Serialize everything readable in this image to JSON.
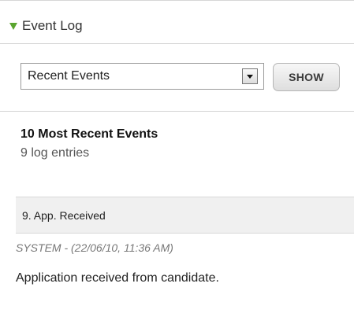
{
  "panel": {
    "title": "Event Log"
  },
  "filter": {
    "selected": "Recent Events",
    "show_label": "SHOW"
  },
  "events": {
    "heading": "10 Most Recent Events",
    "count": "9 log entries"
  },
  "entries": [
    {
      "title": "9. App. Received",
      "meta": "SYSTEM - (22/06/10, 11:36 AM)",
      "text": "Application received from candidate."
    }
  ],
  "icons": {
    "expand": "triangle-down-icon",
    "dropdown": "chevron-down-icon"
  },
  "colors": {
    "accent": "#5aa52f",
    "entry_bg": "#f0f0f0",
    "border": "#d4d4d4"
  }
}
